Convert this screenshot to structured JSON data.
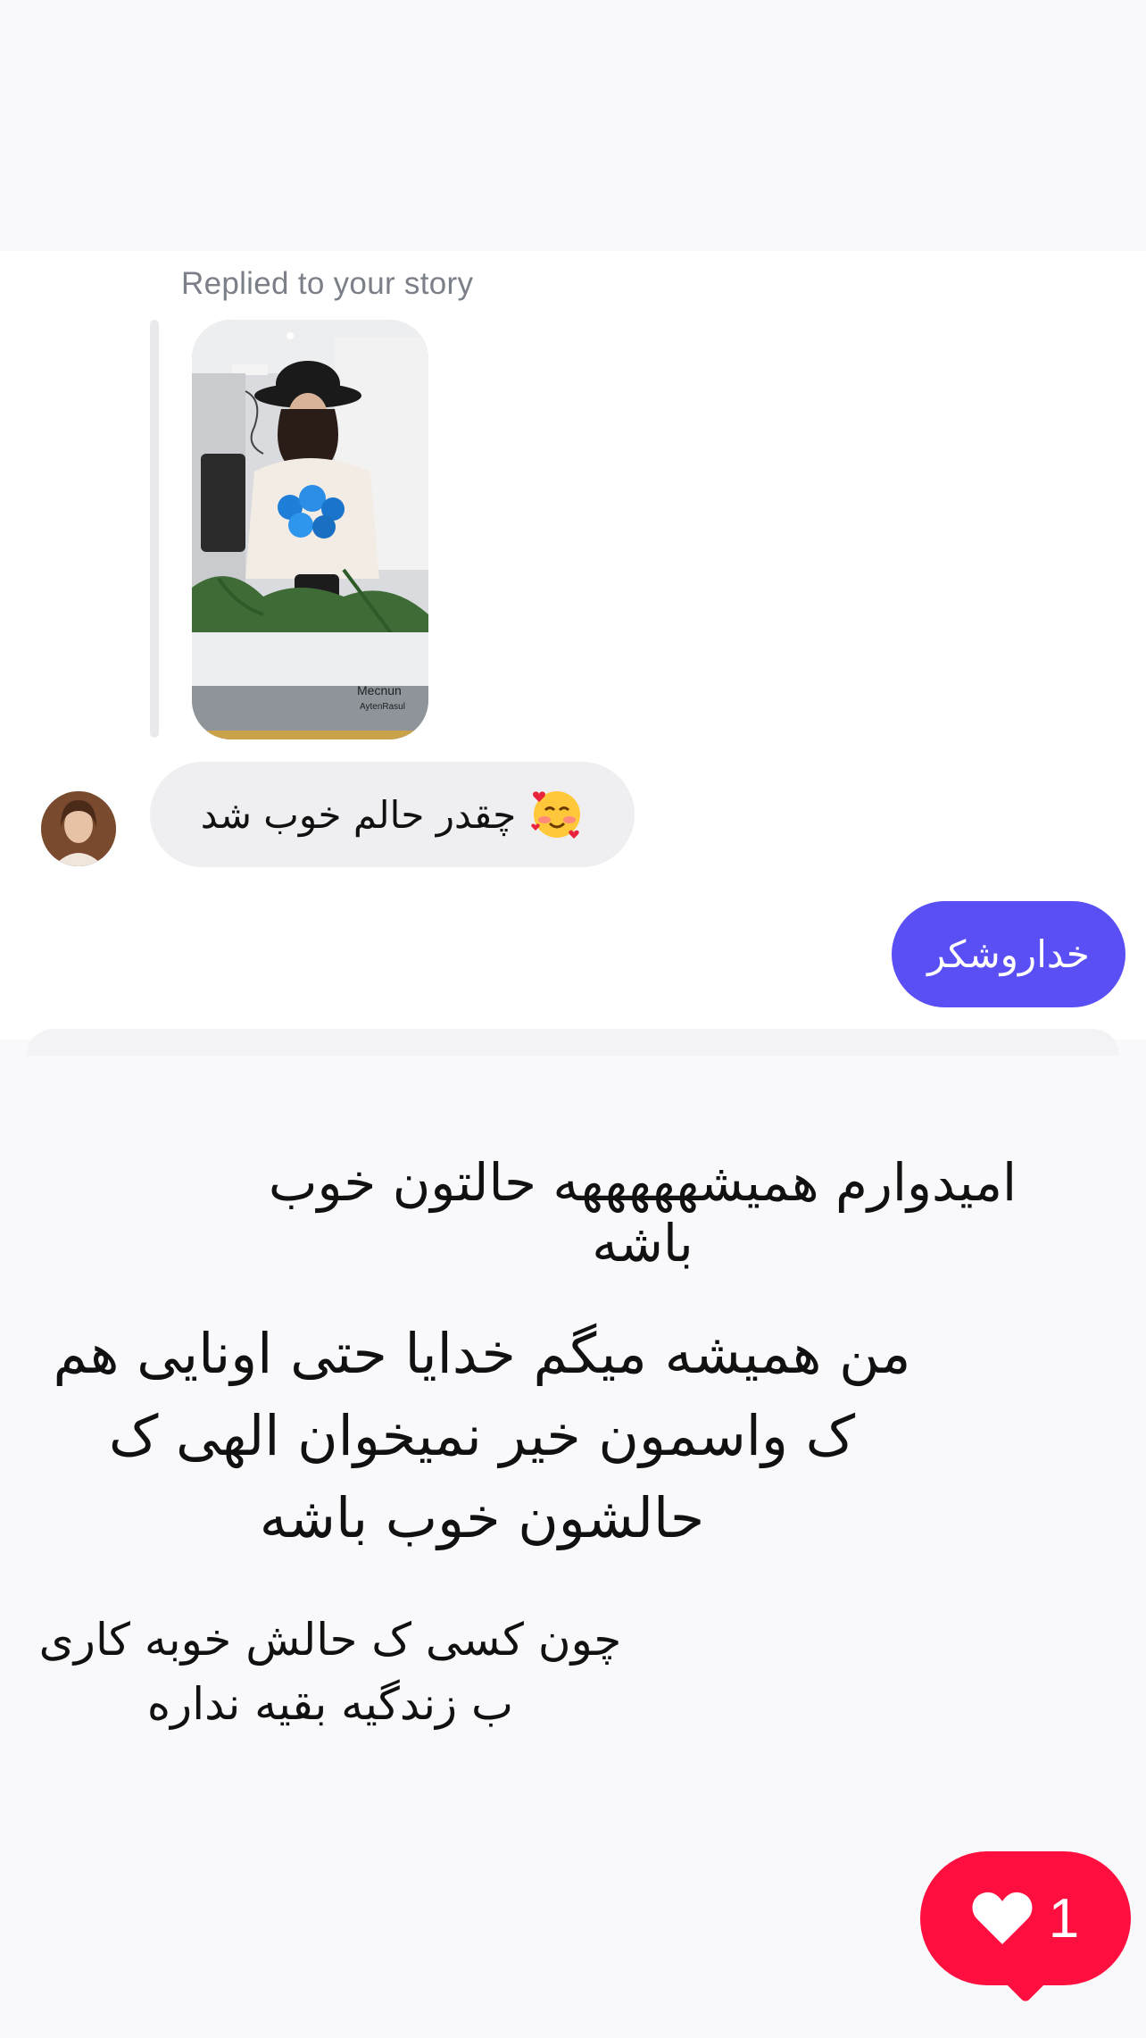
{
  "conversation": {
    "reply_label": "Replied to your story",
    "story_thumbnail": {
      "caption_line1": "Mecnun",
      "caption_line2": "AytenRasul"
    },
    "incoming_message": {
      "text": "چقدر حالم خوب شد",
      "emoji": "smiling-face-with-hearts-emoji"
    },
    "outgoing_message": {
      "text": "خداروشکر"
    }
  },
  "story_text": {
    "line1": "امیدوارم همیشهههههه حالتون خوب باشه",
    "line2": "من همیشه میگم خدایا حتی اونایی هم ک واسمون خیر نمیخوان الهی ک حالشون خوب باشه",
    "line3": "چون کسی ک حالش خوبه کاری ب زندگیه بقیه نداره"
  },
  "like_badge": {
    "icon": "heart-icon",
    "count": "1",
    "color": "#ff0f3f"
  },
  "colors": {
    "outgoing_bubble": "#5a4ff5",
    "incoming_bubble": "#efeff2"
  }
}
